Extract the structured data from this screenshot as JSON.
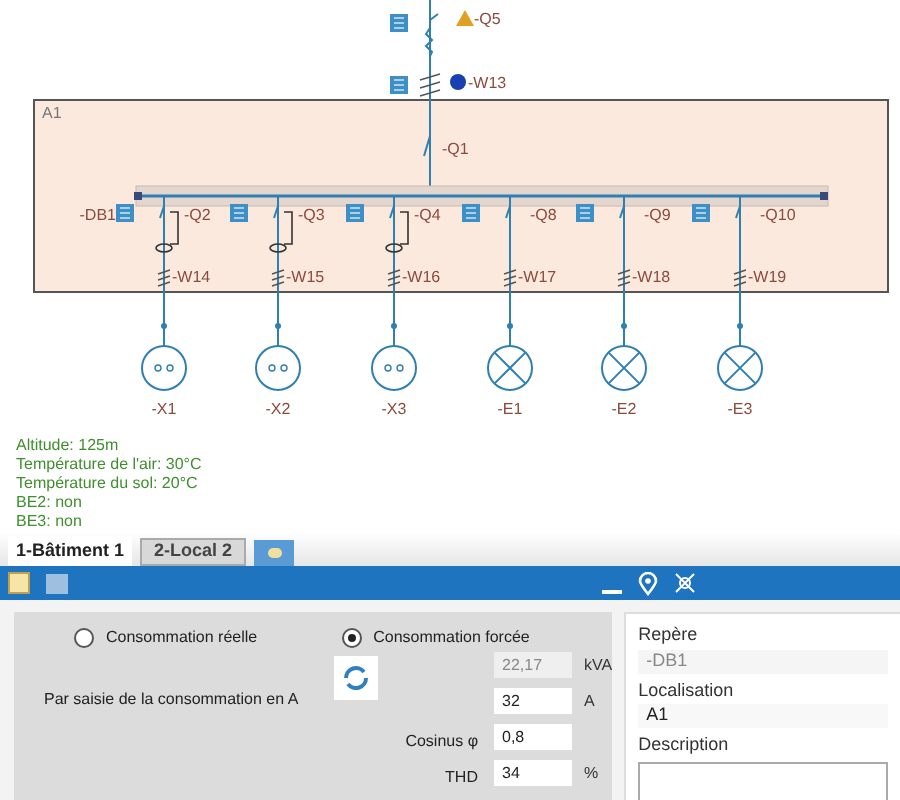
{
  "diagram": {
    "supply": {
      "breaker": "-Q5",
      "breaker_warning": true,
      "cable": "-W13",
      "cable_info": true
    },
    "area": {
      "label": "A1",
      "main_breaker": "-Q1",
      "busbar": "-DB1"
    },
    "branches": [
      {
        "breaker": "-Q2",
        "cable": "-W14",
        "load": "-X1",
        "kind": "socket"
      },
      {
        "breaker": "-Q3",
        "cable": "-W15",
        "load": "-X2",
        "kind": "socket"
      },
      {
        "breaker": "-Q4",
        "cable": "-W16",
        "load": "-X3",
        "kind": "socket"
      },
      {
        "breaker": "-Q8",
        "cable": "-W17",
        "load": "-E1",
        "kind": "lamp"
      },
      {
        "breaker": "-Q9",
        "cable": "-W18",
        "load": "-E2",
        "kind": "lamp"
      },
      {
        "breaker": "-Q10",
        "cable": "-W19",
        "load": "-E3",
        "kind": "lamp"
      }
    ]
  },
  "conditions": [
    "Altitude: 125m",
    "Température de l'air: 30°C",
    "Température du sol: 20°C",
    "BE2: non",
    "BE3: non"
  ],
  "tabs": [
    {
      "label": "1-Bâtiment 1",
      "selected": true
    },
    {
      "label": "2-Local 2",
      "selected": false
    }
  ],
  "consumption": {
    "options": [
      {
        "label": "Consommation réelle",
        "selected": false
      },
      {
        "label": "Consommation forcée",
        "selected": true
      }
    ],
    "method": "Par saisie de la consommation en A",
    "fields": [
      {
        "value": "22,17",
        "unit": "kVA",
        "disabled": true
      },
      {
        "value": "32",
        "unit": "A",
        "disabled": false
      },
      {
        "label": "Cosinus φ",
        "value": "0,8",
        "disabled": false
      },
      {
        "label": "THD",
        "value": "34",
        "unit": "%",
        "disabled": false
      }
    ]
  },
  "properties": {
    "reference": {
      "label": "Repère",
      "value": "-DB1"
    },
    "location": {
      "label": "Localisation",
      "value": "A1"
    },
    "description": {
      "label": "Description"
    }
  }
}
